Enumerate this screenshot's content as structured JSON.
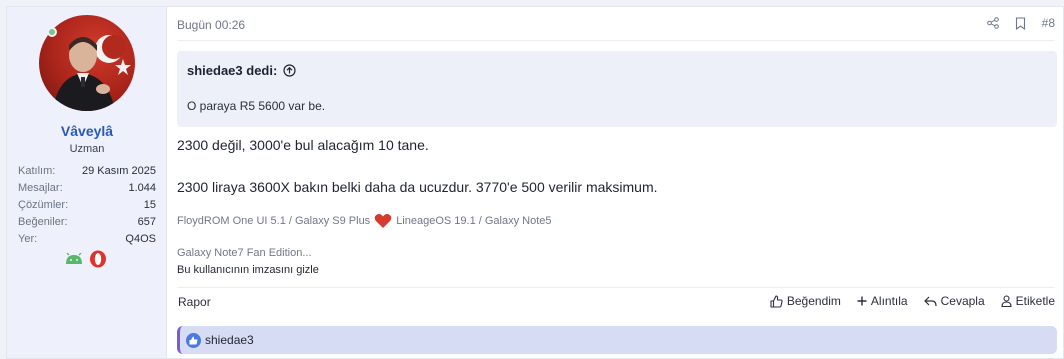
{
  "user": {
    "name": "Vâveylâ",
    "title": "Uzman",
    "stats": [
      {
        "key": "Katılım:",
        "value": "29 Kasım 2025"
      },
      {
        "key": "Mesajlar:",
        "value": "1.044"
      },
      {
        "key": "Çözümler:",
        "value": "15"
      },
      {
        "key": "Beğeniler:",
        "value": "657"
      },
      {
        "key": "Yer:",
        "value": "Q4OS"
      }
    ],
    "badges": [
      "android-icon",
      "opera-icon"
    ],
    "online": true
  },
  "post": {
    "time": "Bugün 00:26",
    "number": "#8",
    "quote": {
      "author": "shiedae3 dedi:",
      "text": "O paraya R5 5600 var be."
    },
    "message": [
      "2300 değil, 3000'e bul alacağım 10 tane.",
      "2300 liraya 3600X bakın belki daha da ucuzdur. 3770'e 500 verilir maksimum."
    ],
    "signature": {
      "part1": "FloydROM One UI 5.1 / Galaxy S9 Plus",
      "part2": "LineageOS 19.1 / Galaxy Note5",
      "line2": "Galaxy Note7 Fan Edition...",
      "hide": "Bu kullanıcının imzasını gizle"
    },
    "report": "Rapor",
    "actions": {
      "like": "Beğendim",
      "quote": "Alıntıla",
      "reply": "Cevapla",
      "tag": "Etiketle"
    },
    "reactions": {
      "users": "shiedae3"
    }
  },
  "colors": {
    "accent": "#2a58b8",
    "heart": "#d63a2c",
    "like": "#4a7ae0"
  }
}
